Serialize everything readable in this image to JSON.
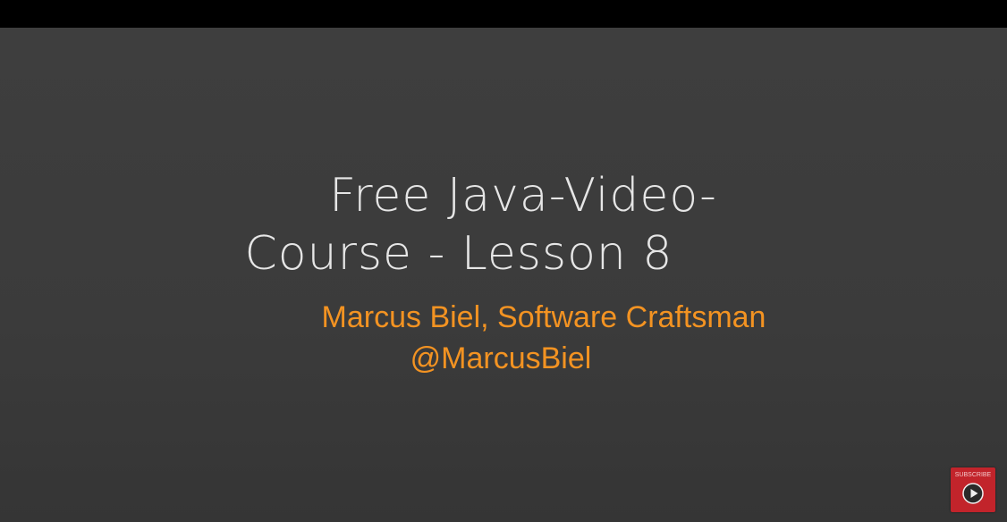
{
  "video": {
    "title_line1": "Free Java-Video-",
    "title_line2": "Course - Lesson 8",
    "author_line": "Marcus Biel, Software Craftsman",
    "handle": "@MarcusBiel"
  },
  "subscribe": {
    "label": "SUBSCRIBE",
    "icon": "play-icon"
  },
  "colors": {
    "background": "#3b3b3b",
    "top_bar": "#000000",
    "title": "#e6e6e6",
    "accent": "#f39322",
    "subscribe_bg": "#c2242b"
  }
}
